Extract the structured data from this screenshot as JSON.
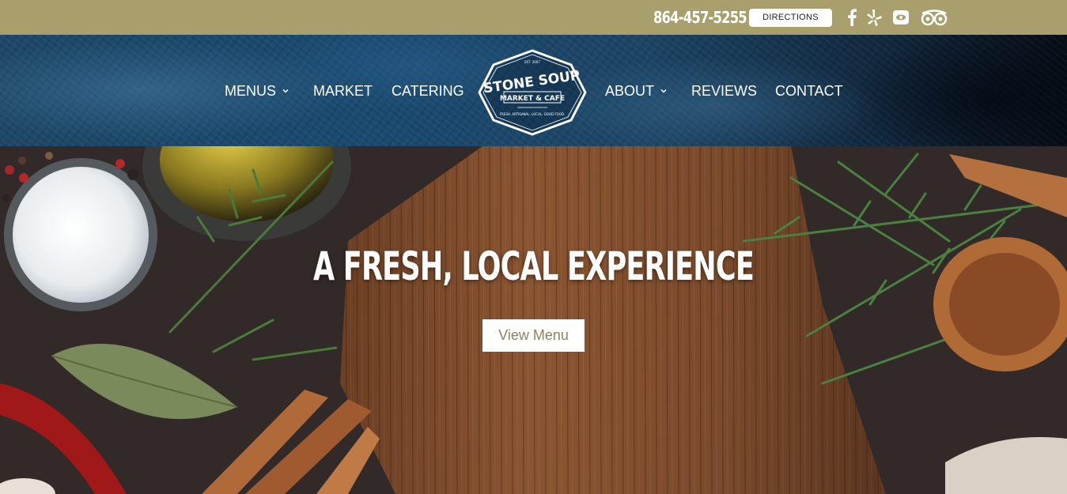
{
  "topbar": {
    "phone": "864-457-5255",
    "directions_label": "DIRECTIONS",
    "social_icons": [
      "facebook-icon",
      "yelp-icon",
      "foursquare-icon",
      "tripadvisor-icon"
    ],
    "background": "#a89f6c"
  },
  "nav": {
    "left_items": [
      {
        "label": "MENUS",
        "has_dropdown": true
      },
      {
        "label": "MARKET",
        "has_dropdown": false
      },
      {
        "label": "CATERING",
        "has_dropdown": false
      }
    ],
    "right_items": [
      {
        "label": "ABOUT",
        "has_dropdown": true
      },
      {
        "label": "REVIEWS",
        "has_dropdown": false
      },
      {
        "label": "CONTACT",
        "has_dropdown": false
      }
    ],
    "logo": {
      "line1": "STONE SOUP",
      "line2": "MARKET & CAFE",
      "tagline": "FRESH. ARTISANAL. LOCAL. GOOD FOOD.",
      "est": "EST. 2007"
    }
  },
  "hero": {
    "title": "A FRESH, LOCAL EXPERIENCE",
    "button_label": "View Menu",
    "button_text_color": "#8a8460"
  }
}
